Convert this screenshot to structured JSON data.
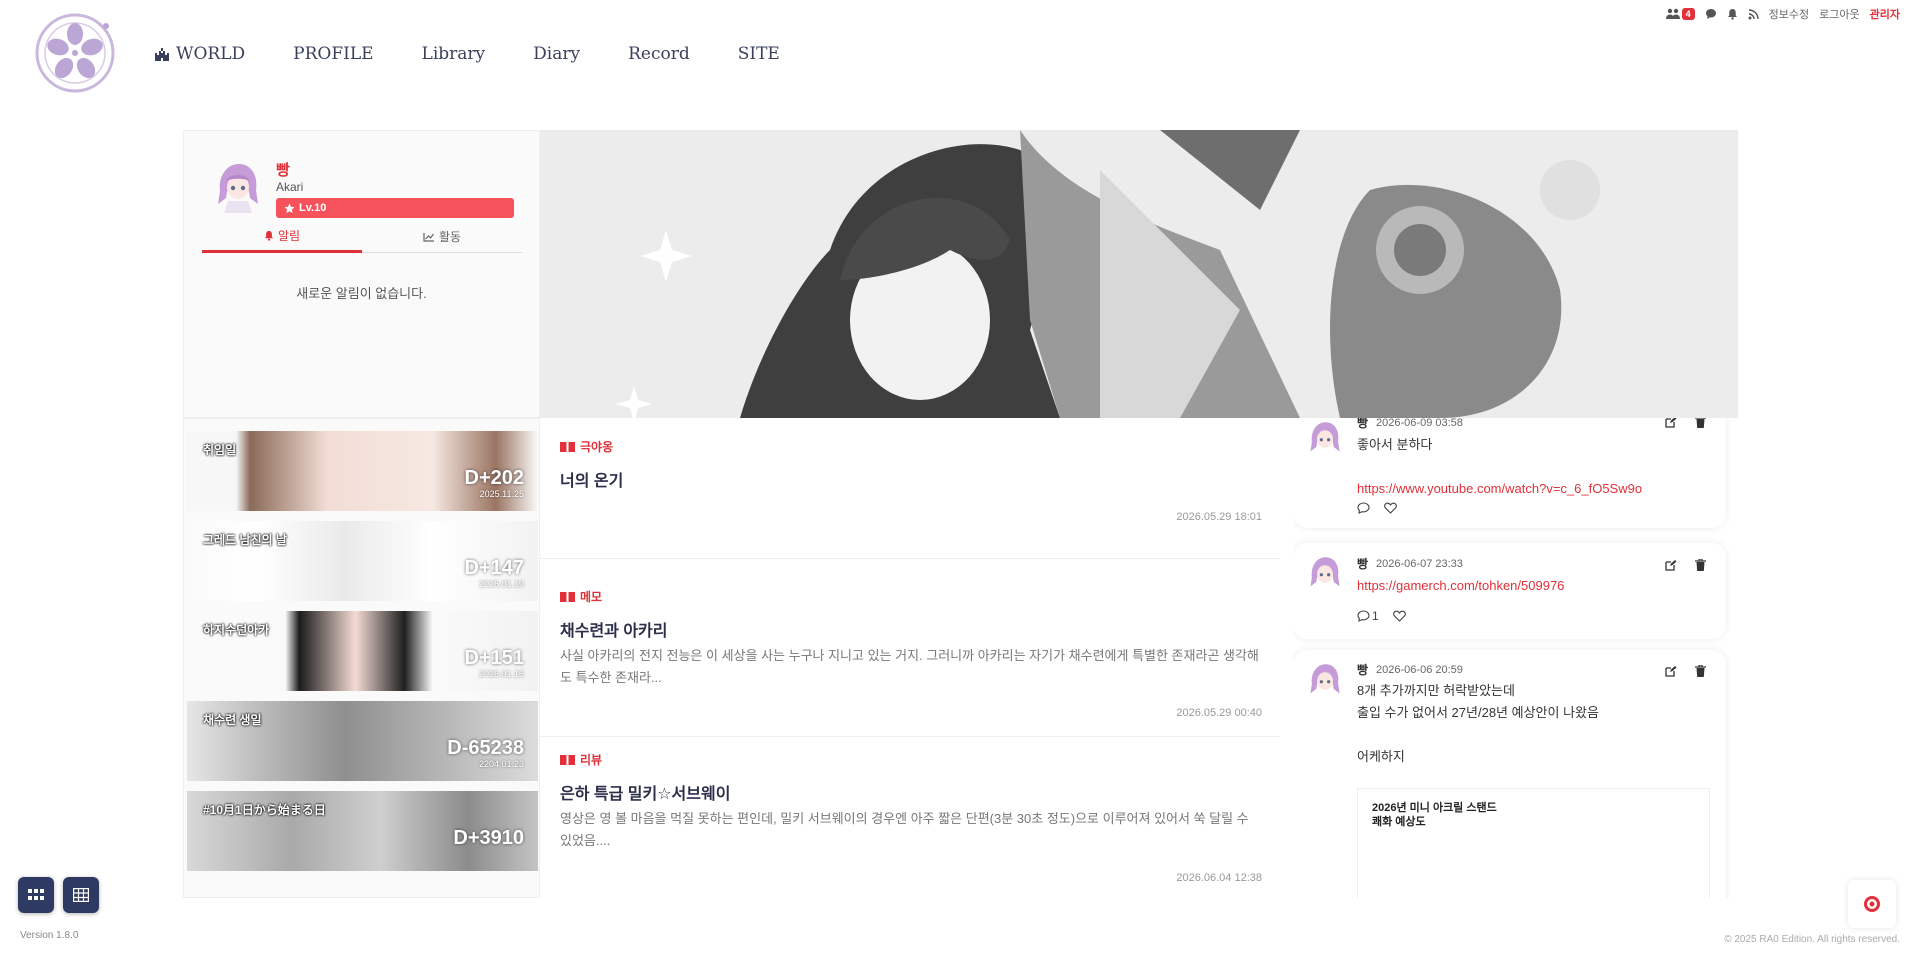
{
  "topbar": {
    "member_count": "4",
    "edit_info": "정보수정",
    "logout": "로그아웃",
    "admin": "관리자"
  },
  "nav": {
    "items": [
      "WORLD",
      "PROFILE",
      "Library",
      "Diary",
      "Record",
      "SITE"
    ]
  },
  "profile": {
    "name": "빵",
    "sub": "Akari",
    "level": "Lv.10",
    "tab_alert": "알림",
    "tab_activity": "활동",
    "empty": "새로운 알림이 없습니다."
  },
  "ddays": [
    {
      "title": "취임일",
      "count": "D+202",
      "date": "2025.11.25"
    },
    {
      "title": "그레드 남친의 날",
      "count": "D+147",
      "date": "2026.01.19"
    },
    {
      "title": "하지수던아카",
      "count": "D+151",
      "date": "2026.01.15"
    },
    {
      "title": "채수련 생일",
      "count": "D-65238",
      "date": "2204.01.23"
    },
    {
      "title": "#10月1日から始まる日",
      "count": "D+3910",
      "date": ""
    }
  ],
  "posts": [
    {
      "category": "극야옹",
      "title": "너의 온기",
      "body": "",
      "date": "2026.05.29 18:01"
    },
    {
      "category": "메모",
      "title": "채수련과 아카리",
      "body": "사실 아카리의 전지 전능은 이 세상을 사는 누구나 지니고 있는 거지. 그러니까 아카리는 자기가 채수련에게 특별한 존재라곤 생각해도 특수한 존재라...",
      "date": "2026.05.29 00:40"
    },
    {
      "category": "리뷰",
      "title": "은하 특급 밀키☆서브웨이",
      "body": "영상은 영 볼 마음을 먹질 못하는 편인데, 밀키 서브웨이의 경우엔 아주 짧은 단편(3분 30초 정도)으로 이루어져 있어서 쑥 달릴 수 있었음....",
      "date": "2026.06.04 12:38"
    }
  ],
  "feed": [
    {
      "author": "빵",
      "time": "2026-06-09 03:58",
      "lines": [
        "좋아서 분하다",
        ""
      ],
      "link": "https://www.youtube.com/watch?v=c_6_fO5Sw9o",
      "comments": ""
    },
    {
      "author": "빵",
      "time": "2026-06-07 23:33",
      "lines": [],
      "link": "https://gamerch.com/tohken/509976",
      "comments": "1"
    },
    {
      "author": "빵",
      "time": "2026-06-06 20:59",
      "lines": [
        "8개 추가까지만 허락받았는데",
        "출입 수가 없어서 27년/28년 예상안이 나왔음",
        "",
        "어케하지"
      ],
      "link": "",
      "image_title_1": "2026년 미니 아크릴 스탠드",
      "image_title_2": "쾌화 예상도"
    }
  ],
  "footer": {
    "version": "Version 1.8.0",
    "copyright": "© 2025 RA0 Edition. All rights reserved."
  },
  "colors": {
    "accent": "#e0303a",
    "nav": "#3a3f5c",
    "fab": "#2f3a62"
  }
}
